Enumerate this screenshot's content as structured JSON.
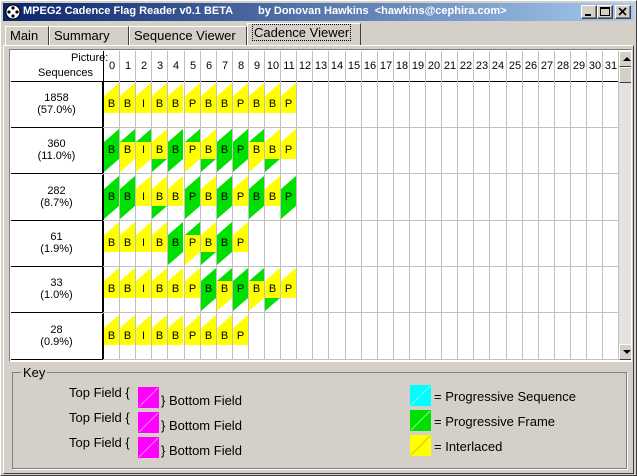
{
  "window": {
    "title": "MPEG2 Cadence Flag Reader v0.1 BETA",
    "author": "by Donovan Hawkins  <hawkins@cephira.com>",
    "app_icon": "film-reel-icon"
  },
  "tabs": [
    {
      "label": "Main",
      "active": false
    },
    {
      "label": "Summary",
      "active": false
    },
    {
      "label": "Sequence Viewer",
      "active": false
    },
    {
      "label": "Cadence Viewer",
      "active": true
    }
  ],
  "grid": {
    "header_picture": "Picture:",
    "header_sequences": "Sequences",
    "columns": [
      "0",
      "1",
      "2",
      "3",
      "4",
      "5",
      "6",
      "7",
      "8",
      "9",
      "10",
      "11",
      "12",
      "13",
      "14",
      "15",
      "16",
      "17",
      "18",
      "19",
      "20",
      "21",
      "22",
      "23",
      "24",
      "25",
      "26",
      "27",
      "28",
      "29",
      "30",
      "31"
    ],
    "rows": [
      {
        "count": "1858",
        "percent": "(57.0%)",
        "pictures": [
          {
            "t": "B",
            "top": "I",
            "bot": "I"
          },
          {
            "t": "B",
            "top": "I",
            "bot": "I"
          },
          {
            "t": "I",
            "top": "I",
            "bot": "I"
          },
          {
            "t": "B",
            "top": "I",
            "bot": "I"
          },
          {
            "t": "B",
            "top": "I",
            "bot": "I"
          },
          {
            "t": "P",
            "top": "I",
            "bot": "I"
          },
          {
            "t": "B",
            "top": "I",
            "bot": "I"
          },
          {
            "t": "B",
            "top": "I",
            "bot": "I"
          },
          {
            "t": "P",
            "top": "I",
            "bot": "I"
          },
          {
            "t": "B",
            "top": "I",
            "bot": "I"
          },
          {
            "t": "B",
            "top": "I",
            "bot": "I"
          },
          {
            "t": "P",
            "top": "I",
            "bot": "I"
          }
        ]
      },
      {
        "count": "360",
        "percent": "(11.0%)",
        "pictures": [
          {
            "t": "B",
            "top": "P",
            "bot": "P"
          },
          {
            "t": "B",
            "top": "P",
            "bot": "I"
          },
          {
            "t": "I",
            "top": "P",
            "bot": "I"
          },
          {
            "t": "B",
            "top": "I",
            "bot": "P"
          },
          {
            "t": "B",
            "top": "P",
            "bot": "P"
          },
          {
            "t": "P",
            "top": "P",
            "bot": "I"
          },
          {
            "t": "B",
            "top": "I",
            "bot": "P"
          },
          {
            "t": "B",
            "top": "P",
            "bot": "P"
          },
          {
            "t": "P",
            "top": "P",
            "bot": "P"
          },
          {
            "t": "B",
            "top": "P",
            "bot": "I"
          },
          {
            "t": "B",
            "top": "I",
            "bot": "P"
          },
          {
            "t": "P",
            "top": "I",
            "bot": "I"
          }
        ]
      },
      {
        "count": "282",
        "percent": "(8.7%)",
        "pictures": [
          {
            "t": "B",
            "top": "P",
            "bot": "P"
          },
          {
            "t": "B",
            "top": "P",
            "bot": "P"
          },
          {
            "t": "I",
            "top": "I",
            "bot": "I"
          },
          {
            "t": "B",
            "top": "I",
            "bot": "P"
          },
          {
            "t": "B",
            "top": "I",
            "bot": "I"
          },
          {
            "t": "P",
            "top": "P",
            "bot": "P"
          },
          {
            "t": "B",
            "top": "I",
            "bot": "I"
          },
          {
            "t": "B",
            "top": "P",
            "bot": "P"
          },
          {
            "t": "P",
            "top": "I",
            "bot": "I"
          },
          {
            "t": "B",
            "top": "P",
            "bot": "P"
          },
          {
            "t": "B",
            "top": "I",
            "bot": "I"
          },
          {
            "t": "P",
            "top": "P",
            "bot": "P"
          }
        ]
      },
      {
        "count": "61",
        "percent": "(1.9%)",
        "pictures": [
          {
            "t": "B",
            "top": "I",
            "bot": "I"
          },
          {
            "t": "B",
            "top": "I",
            "bot": "I"
          },
          {
            "t": "I",
            "top": "I",
            "bot": "I"
          },
          {
            "t": "B",
            "top": "I",
            "bot": "I"
          },
          {
            "t": "B",
            "top": "P",
            "bot": "P"
          },
          {
            "t": "P",
            "top": "P",
            "bot": "I"
          },
          {
            "t": "B",
            "top": "I",
            "bot": "P"
          },
          {
            "t": "B",
            "top": "P",
            "bot": "P"
          },
          {
            "t": "P",
            "top": "I",
            "bot": "I"
          }
        ]
      },
      {
        "count": "33",
        "percent": "(1.0%)",
        "pictures": [
          {
            "t": "B",
            "top": "I",
            "bot": "I"
          },
          {
            "t": "B",
            "top": "I",
            "bot": "I"
          },
          {
            "t": "I",
            "top": "I",
            "bot": "I"
          },
          {
            "t": "B",
            "top": "I",
            "bot": "I"
          },
          {
            "t": "B",
            "top": "I",
            "bot": "I"
          },
          {
            "t": "P",
            "top": "I",
            "bot": "I"
          },
          {
            "t": "B",
            "top": "P",
            "bot": "P"
          },
          {
            "t": "B",
            "top": "P",
            "bot": "I"
          },
          {
            "t": "P",
            "top": "P",
            "bot": "P"
          },
          {
            "t": "B",
            "top": "P",
            "bot": "I"
          },
          {
            "t": "B",
            "top": "I",
            "bot": "P"
          },
          {
            "t": "P",
            "top": "I",
            "bot": "I"
          }
        ]
      },
      {
        "count": "28",
        "percent": "(0.9%)",
        "pictures": [
          {
            "t": "B",
            "top": "I",
            "bot": "I"
          },
          {
            "t": "B",
            "top": "I",
            "bot": "I"
          },
          {
            "t": "I",
            "top": "I",
            "bot": "I"
          },
          {
            "t": "B",
            "top": "I",
            "bot": "I"
          },
          {
            "t": "B",
            "top": "I",
            "bot": "I"
          },
          {
            "t": "P",
            "top": "I",
            "bot": "I"
          },
          {
            "t": "B",
            "top": "I",
            "bot": "I"
          },
          {
            "t": "B",
            "top": "I",
            "bot": "I"
          },
          {
            "t": "P",
            "top": "I",
            "bot": "I"
          }
        ]
      }
    ]
  },
  "key": {
    "title": "Key",
    "top_field": "Top Field {",
    "bottom_field": "} Bottom Field",
    "progressive_sequence": "= Progressive Sequence",
    "progressive_frame": "= Progressive Frame",
    "interlaced": "= Interlaced"
  },
  "colors": {
    "interlaced": "#ffff00",
    "progressive_frame": "#00e000",
    "progressive_sequence": "#00ffff",
    "field_marker": "#ff00ff"
  }
}
